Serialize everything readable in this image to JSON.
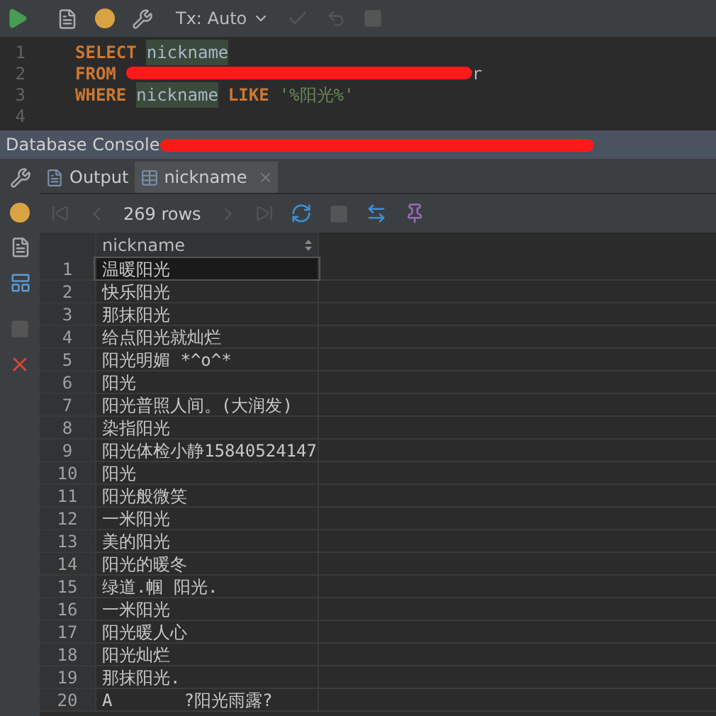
{
  "toolbar": {
    "tx_label": "Tx: Auto"
  },
  "editor": {
    "lines": [
      {
        "number": "1",
        "tokens": [
          {
            "kind": "keyword",
            "text": "SELECT"
          },
          {
            "kind": "ident",
            "text": "nickname"
          }
        ]
      },
      {
        "number": "2",
        "tokens": [
          {
            "kind": "keyword",
            "text": "FROM"
          },
          {
            "kind": "redacted",
            "text": "r"
          }
        ]
      },
      {
        "number": "3",
        "tokens": [
          {
            "kind": "keyword",
            "text": "WHERE"
          },
          {
            "kind": "ident",
            "text": "nickname"
          },
          {
            "kind": "keyword",
            "text": "LIKE"
          },
          {
            "kind": "string",
            "text": "'%阳光%'"
          }
        ]
      },
      {
        "number": "4"
      }
    ]
  },
  "console": {
    "title": "Database Console"
  },
  "tabs": [
    {
      "label": "Output",
      "kind": "output",
      "selected": false
    },
    {
      "label": "nickname",
      "kind": "table",
      "selected": true,
      "close": "×"
    }
  ],
  "result": {
    "row_count": "269 rows",
    "columns": [
      "nickname"
    ],
    "rows": [
      {
        "number": "1",
        "nickname": "温暖阳光",
        "selected": true
      },
      {
        "number": "2",
        "nickname": "快乐阳光",
        "selected": false
      },
      {
        "number": "3",
        "nickname": "那抹阳光",
        "selected": false
      },
      {
        "number": "4",
        "nickname": "给点阳光就灿烂",
        "selected": false
      },
      {
        "number": "5",
        "nickname": "阳光明媚 *^o^*",
        "selected": false
      },
      {
        "number": "6",
        "nickname": "阳光",
        "selected": false
      },
      {
        "number": "7",
        "nickname": "阳光普照人间。(大润发)",
        "selected": false
      },
      {
        "number": "8",
        "nickname": "染指阳光",
        "selected": false
      },
      {
        "number": "9",
        "nickname": "阳光体检小静15840524147",
        "selected": false
      },
      {
        "number": "10",
        "nickname": "阳光",
        "selected": false
      },
      {
        "number": "11",
        "nickname": "阳光般微笑",
        "selected": false
      },
      {
        "number": "12",
        "nickname": "一米阳光",
        "selected": false
      },
      {
        "number": "13",
        "nickname": "美的阳光",
        "selected": false
      },
      {
        "number": "14",
        "nickname": "阳光的暖冬",
        "selected": false
      },
      {
        "number": "15",
        "nickname": "绿道.帼 阳光.",
        "selected": false
      },
      {
        "number": "16",
        "nickname": "一米阳光",
        "selected": false
      },
      {
        "number": "17",
        "nickname": "阳光暖人心",
        "selected": false
      },
      {
        "number": "18",
        "nickname": "阳光灿烂",
        "selected": false
      },
      {
        "number": "19",
        "nickname": "那抹阳光.",
        "selected": false
      },
      {
        "number": "20",
        "nickname": "A       ?阳光雨露?",
        "selected": false
      }
    ]
  }
}
